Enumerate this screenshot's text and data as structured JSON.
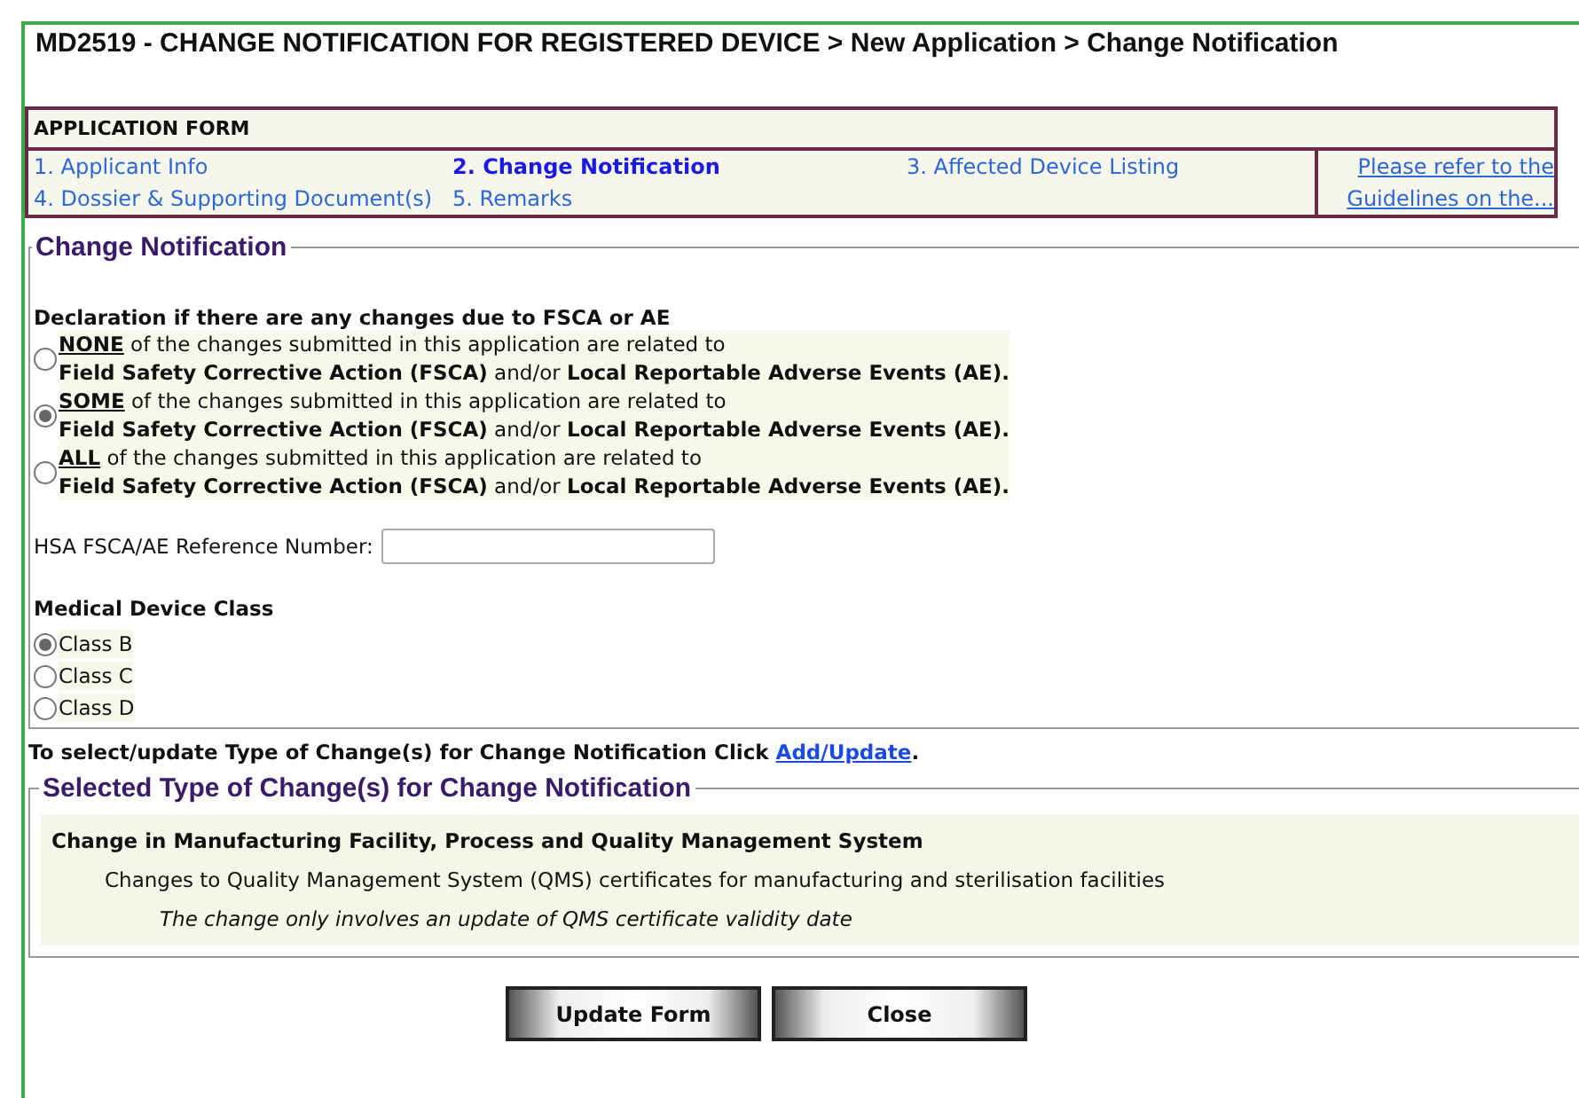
{
  "page_title": "MD2519 - CHANGE NOTIFICATION FOR REGISTERED DEVICE > New Application > Change Notification",
  "application_form": {
    "heading": "APPLICATION FORM",
    "steps": [
      {
        "label": "1. Applicant Info",
        "selected": false
      },
      {
        "label": "2. Change Notification",
        "selected": true
      },
      {
        "label": "3. Affected Device Listing",
        "selected": false
      },
      {
        "label": "4. Dossier & Supporting Document(s)",
        "selected": false
      },
      {
        "label": "5. Remarks",
        "selected": false
      }
    ],
    "guidelines_link": [
      "Please refer to the",
      "Guidelines on the..."
    ]
  },
  "change_notification": {
    "legend": "Change Notification",
    "declaration_label": "Declaration if there are any changes due to FSCA or AE",
    "declaration_options": [
      {
        "keyword": "NONE",
        "line1": "of the changes submitted in this application are related to",
        "line2": "**Field Safety Corrective Action (FSCA)** and/or **Local Reportable Adverse Events (AE).**",
        "selected": false
      },
      {
        "keyword": "SOME",
        "line1": "of the changes submitted in this application are related to",
        "line2": "**Field Safety Corrective Action (FSCA)** and/or **Local Reportable Adverse Events (AE).**",
        "selected": true
      },
      {
        "keyword": "ALL",
        "line1": "of the changes submitted in this application are related to",
        "line2": "**Field Safety Corrective Action (FSCA)** and/or **Local Reportable Adverse Events (AE).**",
        "selected": false
      }
    ],
    "reference_label": "HSA FSCA/AE Reference Number:",
    "class_label": "Medical Device Class",
    "class_options": [
      {
        "label": "Class B",
        "selected": true
      },
      {
        "label": "Class C",
        "selected": false
      },
      {
        "label": "Class D",
        "selected": false
      }
    ]
  },
  "instruction": {
    "text": "To select/update Type of Change(s) for Change Notification Click ",
    "link": "Add/Update",
    "end": "."
  },
  "selected_changes": {
    "legend": "Selected Type of Change(s) for Change Notification",
    "category": "Change in Manufacturing Facility, Process and Quality Management System",
    "change": "Changes to Quality Management System (QMS) certificates for manufacturing and sterilisation facilities",
    "detail": "The change only involves an update of QMS certificate validity date"
  },
  "buttons": [
    "Update Form",
    "Close"
  ]
}
